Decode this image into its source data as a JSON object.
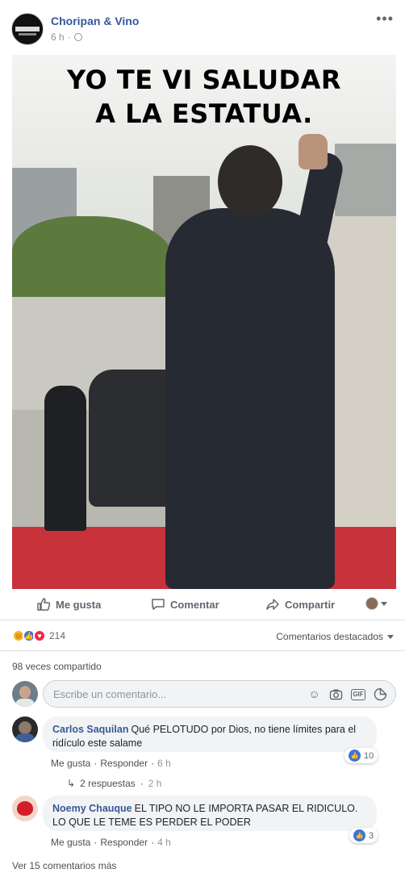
{
  "post": {
    "page_name": "Choripan & Vino",
    "time": "6 h",
    "privacy_icon": "globe-icon",
    "more_icon": "ellipsis-icon",
    "image_caption_line1": "YO TE VI SALUDAR",
    "image_caption_line2": "A LA ESTATUA."
  },
  "actions": {
    "like_label": "Me gusta",
    "comment_label": "Comentar",
    "share_label": "Compartir"
  },
  "stats": {
    "reaction_count": "214",
    "reaction_types": [
      "haha",
      "like",
      "love"
    ],
    "sort_label": "Comentarios destacados",
    "shares_label": "98 veces compartido"
  },
  "composer": {
    "placeholder": "Escribe un comentario..."
  },
  "comments": [
    {
      "author": "Carlos Saquilan",
      "text": "Qué PELOTUDO por Dios, no tiene límites para el ridículo este salame",
      "like_link": "Me gusta",
      "reply_link": "Responder",
      "time": "6 h",
      "likes": "10",
      "replies_label": "2 respuestas",
      "replies_time": "2 h"
    },
    {
      "author": "Noemy Chauque",
      "text": "EL TIPO NO LE IMPORTA PASAR EL RIDICULO. LO QUE LE TEME ES PERDER EL PODER",
      "like_link": "Me gusta",
      "reply_link": "Responder",
      "time": "4 h",
      "likes": "3"
    }
  ],
  "more_comments_label": "Ver 15 comentarios más",
  "colors": {
    "link_blue": "#365899",
    "like_blue": "#3b74d9",
    "love_red": "#f0284a",
    "haha_yellow": "#f7b125",
    "carpet_red": "#c8323a"
  }
}
